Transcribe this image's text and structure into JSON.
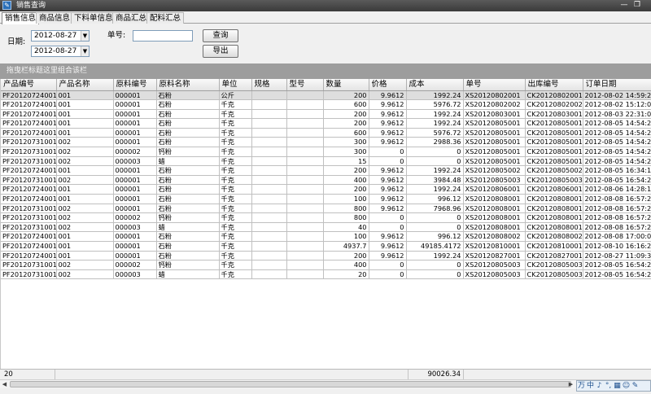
{
  "window": {
    "title": "销售查询",
    "minimize": "—",
    "maximize": "❐"
  },
  "tabs": [
    {
      "label": "销售信息",
      "active": true
    },
    {
      "label": "商品信息",
      "active": false
    },
    {
      "label": "下料单信息",
      "active": false
    },
    {
      "label": "商品汇总",
      "active": false
    },
    {
      "label": "配料汇总",
      "active": false
    }
  ],
  "filters": {
    "date_label": "日期:",
    "date_from": "2012-08-27",
    "date_to": "2012-08-27",
    "order_label": "单号:",
    "order_value": "",
    "query_button": "查询",
    "export_button": "导出"
  },
  "group_panel": {
    "hint": "拖曳栏标题这里组合该栏"
  },
  "grid": {
    "columns": [
      "产品编号",
      "产品名称",
      "原料编号",
      "原料名称",
      "单位",
      "规格",
      "型号",
      "数量",
      "价格",
      "成本",
      "单号",
      "出库编号",
      "订单日期"
    ],
    "rows": [
      [
        "PF20120724001",
        "001",
        "000001",
        "石粉",
        "公斤",
        "",
        "",
        "200",
        "9.9612",
        "1992.24",
        "XS20120802001",
        "CK20120802001",
        "2012-08-02 14:59:28"
      ],
      [
        "PF20120724001",
        "001",
        "000001",
        "石粉",
        "千克",
        "",
        "",
        "600",
        "9.9612",
        "5976.72",
        "XS20120802002",
        "CK20120802002",
        "2012-08-02 15:12:00"
      ],
      [
        "PF20120724001",
        "001",
        "000001",
        "石粉",
        "千克",
        "",
        "",
        "200",
        "9.9612",
        "1992.24",
        "XS20120803001",
        "CK20120803001",
        "2012-08-03 22:31:05"
      ],
      [
        "PF20120724001",
        "001",
        "000001",
        "石粉",
        "千克",
        "",
        "",
        "200",
        "9.9612",
        "1992.24",
        "XS20120805001",
        "CK20120805001",
        "2012-08-05 14:54:28"
      ],
      [
        "PF20120724001",
        "001",
        "000001",
        "石粉",
        "千克",
        "",
        "",
        "600",
        "9.9612",
        "5976.72",
        "XS20120805001",
        "CK20120805001",
        "2012-08-05 14:54:28"
      ],
      [
        "PF20120731001",
        "002",
        "000001",
        "石粉",
        "千克",
        "",
        "",
        "300",
        "9.9612",
        "2988.36",
        "XS20120805001",
        "CK20120805001",
        "2012-08-05 14:54:28"
      ],
      [
        "PF20120731001",
        "002",
        "000002",
        "钙粉",
        "千克",
        "",
        "",
        "300",
        "0",
        "0",
        "XS20120805001",
        "CK20120805001",
        "2012-08-05 14:54:28"
      ],
      [
        "PF20120731001",
        "002",
        "000003",
        "蜡",
        "千克",
        "",
        "",
        "15",
        "0",
        "0",
        "XS20120805001",
        "CK20120805001",
        "2012-08-05 14:54:28"
      ],
      [
        "PF20120724001",
        "001",
        "000001",
        "石粉",
        "千克",
        "",
        "",
        "200",
        "9.9612",
        "1992.24",
        "XS20120805002",
        "CK20120805002",
        "2012-08-05 16:34:19"
      ],
      [
        "PF20120731001",
        "002",
        "000001",
        "石粉",
        "千克",
        "",
        "",
        "400",
        "9.9612",
        "3984.48",
        "XS20120805003",
        "CK20120805003",
        "2012-08-05 16:54:23"
      ],
      [
        "PF20120724001",
        "001",
        "000001",
        "石粉",
        "千克",
        "",
        "",
        "200",
        "9.9612",
        "1992.24",
        "XS20120806001",
        "CK20120806001",
        "2012-08-06 14:28:10"
      ],
      [
        "PF20120724001",
        "001",
        "000001",
        "石粉",
        "千克",
        "",
        "",
        "100",
        "9.9612",
        "996.12",
        "XS20120808001",
        "CK20120808001",
        "2012-08-08 16:57:23"
      ],
      [
        "PF20120731001",
        "002",
        "000001",
        "石粉",
        "千克",
        "",
        "",
        "800",
        "9.9612",
        "7968.96",
        "XS20120808001",
        "CK20120808001",
        "2012-08-08 16:57:23"
      ],
      [
        "PF20120731001",
        "002",
        "000002",
        "钙粉",
        "千克",
        "",
        "",
        "800",
        "0",
        "0",
        "XS20120808001",
        "CK20120808001",
        "2012-08-08 16:57:23"
      ],
      [
        "PF20120731001",
        "002",
        "000003",
        "蜡",
        "千克",
        "",
        "",
        "40",
        "0",
        "0",
        "XS20120808001",
        "CK20120808001",
        "2012-08-08 16:57:23"
      ],
      [
        "PF20120724001",
        "001",
        "000001",
        "石粉",
        "千克",
        "",
        "",
        "100",
        "9.9612",
        "996.12",
        "XS20120808002",
        "CK20120808002",
        "2012-08-08 17:00:02"
      ],
      [
        "PF20120724001",
        "001",
        "000001",
        "石粉",
        "千克",
        "",
        "",
        "4937.7",
        "9.9612",
        "49185.4172",
        "XS20120810001",
        "CK20120810001",
        "2012-08-10 16:16:25"
      ],
      [
        "PF20120724001",
        "001",
        "000001",
        "石粉",
        "千克",
        "",
        "",
        "200",
        "9.9612",
        "1992.24",
        "XS20120827001",
        "CK20120827001",
        "2012-08-27 11:09:34"
      ],
      [
        "PF20120731001",
        "002",
        "000002",
        "钙粉",
        "千克",
        "",
        "",
        "400",
        "0",
        "0",
        "XS20120805003",
        "CK20120805003",
        "2012-08-05 16:54:23"
      ],
      [
        "PF20120731001",
        "002",
        "000003",
        "蜡",
        "千克",
        "",
        "",
        "20",
        "0",
        "0",
        "XS20120805003",
        "CK20120805003",
        "2012-08-05 16:54:23"
      ]
    ]
  },
  "footer": {
    "row_count": "20",
    "total_cost": "90026.34"
  },
  "ime": {
    "items": [
      "万",
      "中",
      "♪",
      "°,",
      "▦",
      "☺",
      "✎"
    ]
  }
}
